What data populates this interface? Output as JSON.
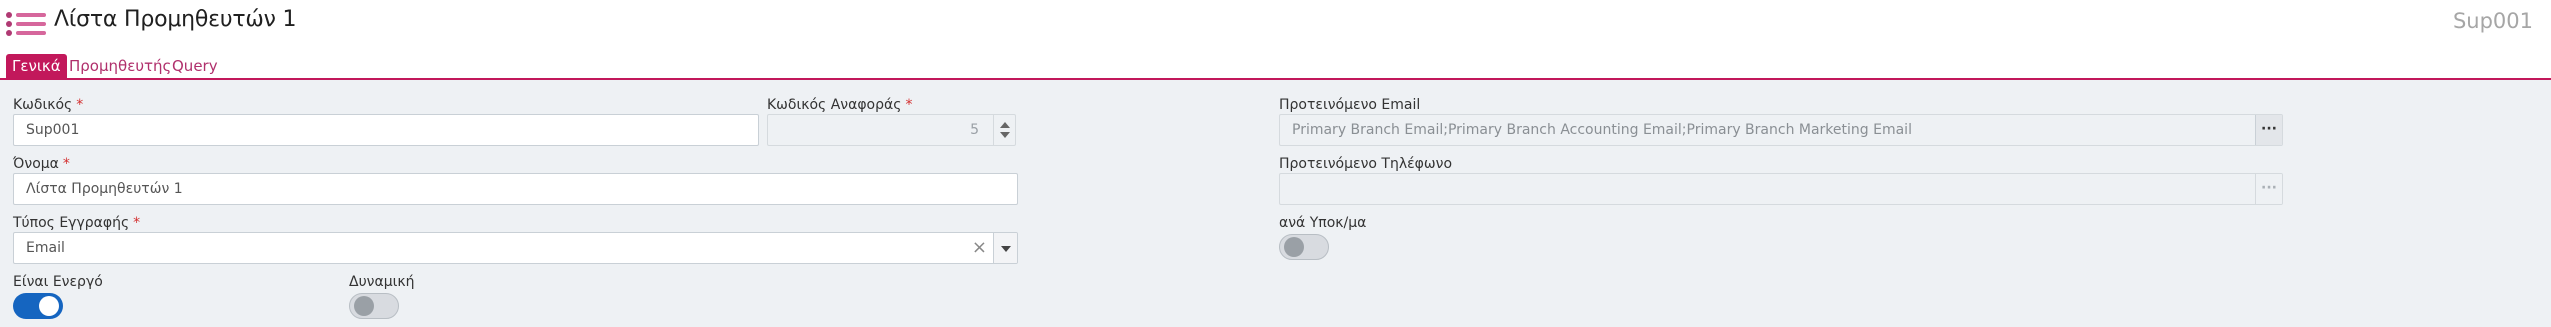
{
  "header": {
    "title": "Λίστα Προμηθευτών 1",
    "record_code": "Sup001"
  },
  "tabs": [
    {
      "label": "Γενικά",
      "active": true
    },
    {
      "label": "Προμηθευτής",
      "active": false
    },
    {
      "label": "Query",
      "active": false
    }
  ],
  "form": {
    "code": {
      "label": "Κωδικός",
      "required": "*",
      "value": "Sup001"
    },
    "ref_code": {
      "label": "Κωδικός Αναφοράς",
      "required": "*",
      "value": "5"
    },
    "name": {
      "label": "Όνομα",
      "required": "*",
      "value": "Λίστα Προμηθευτών 1"
    },
    "entry_type": {
      "label": "Τύπος Εγγραφής",
      "required": "*",
      "value": "Email",
      "clear": "×"
    },
    "is_active": {
      "label": "Είναι Ενεργό",
      "on": true
    },
    "dynamic": {
      "label": "Δυναμική",
      "on": false
    },
    "preferred_email": {
      "label": "Προτεινόμενο Email",
      "value": "Primary Branch Email;Primary Branch Accounting Email;Primary Branch Marketing Email",
      "button": "···"
    },
    "preferred_phone": {
      "label": "Προτεινόμενο Τηλέφωνο",
      "value": "",
      "button": "···"
    },
    "per_branch": {
      "label": "ανά Υποκ/μα",
      "on": false
    }
  },
  "icons": {
    "menu": "hamburger-list-icon",
    "spinner": "spinner-arrows-icon",
    "dropdown": "chevron-down-icon"
  },
  "colors": {
    "accent": "#c2185b",
    "toggle_on": "#1565c0",
    "form_bg": "#eef1f4"
  }
}
